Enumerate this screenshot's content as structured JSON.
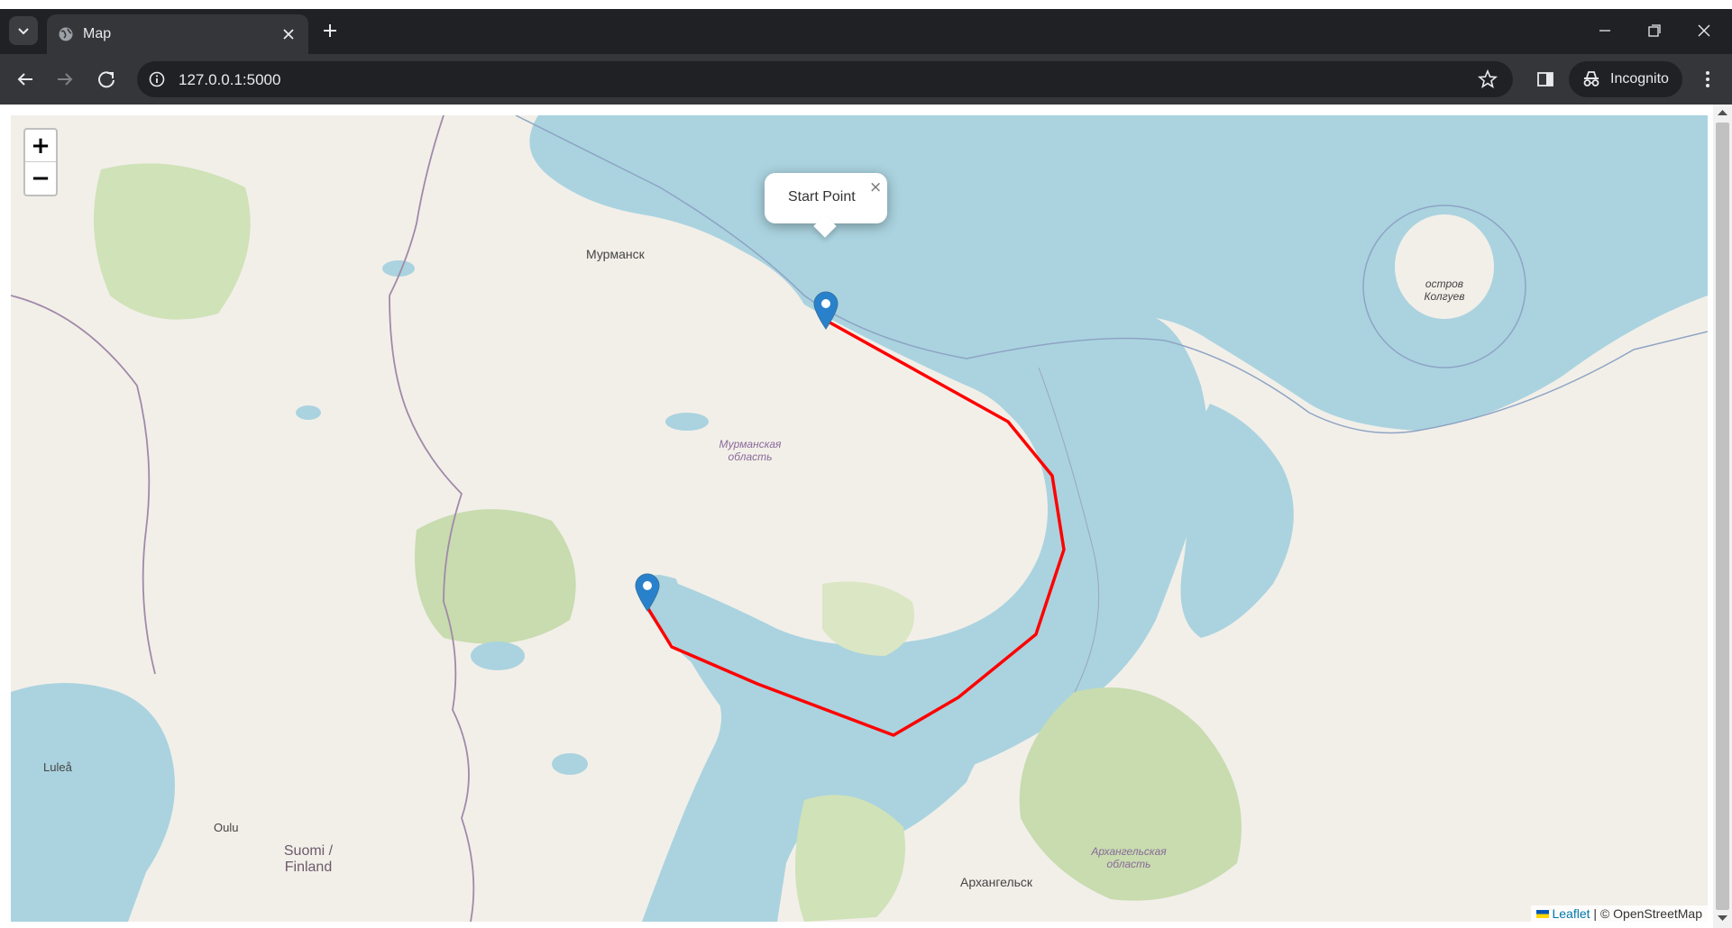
{
  "browser": {
    "tab_title": "Map",
    "url": "127.0.0.1:5000",
    "incognito_label": "Incognito"
  },
  "map": {
    "zoom_in_label": "+",
    "zoom_out_label": "−",
    "popup_text": "Start Point",
    "popup_close": "×",
    "attribution_leaflet": "Leaflet",
    "attribution_rest": " | © OpenStreetMap",
    "route_color": "#ff0000",
    "marker_color": "#2a81cb",
    "labels": {
      "murmansk": "Мурманск",
      "murmansk_oblast_1": "Мурманская",
      "murmansk_oblast_2": "область",
      "kolguev_1": "остров",
      "kolguev_2": "Колгуев",
      "arkhangelsk": "Архангельск",
      "arkhangelsk_oblast_1": "Архангельская",
      "arkhangelsk_oblast_2": "область",
      "oulu": "Oulu",
      "lulea": "Luleå",
      "finland_1": "Suomi /",
      "finland_2": "Finland"
    }
  }
}
